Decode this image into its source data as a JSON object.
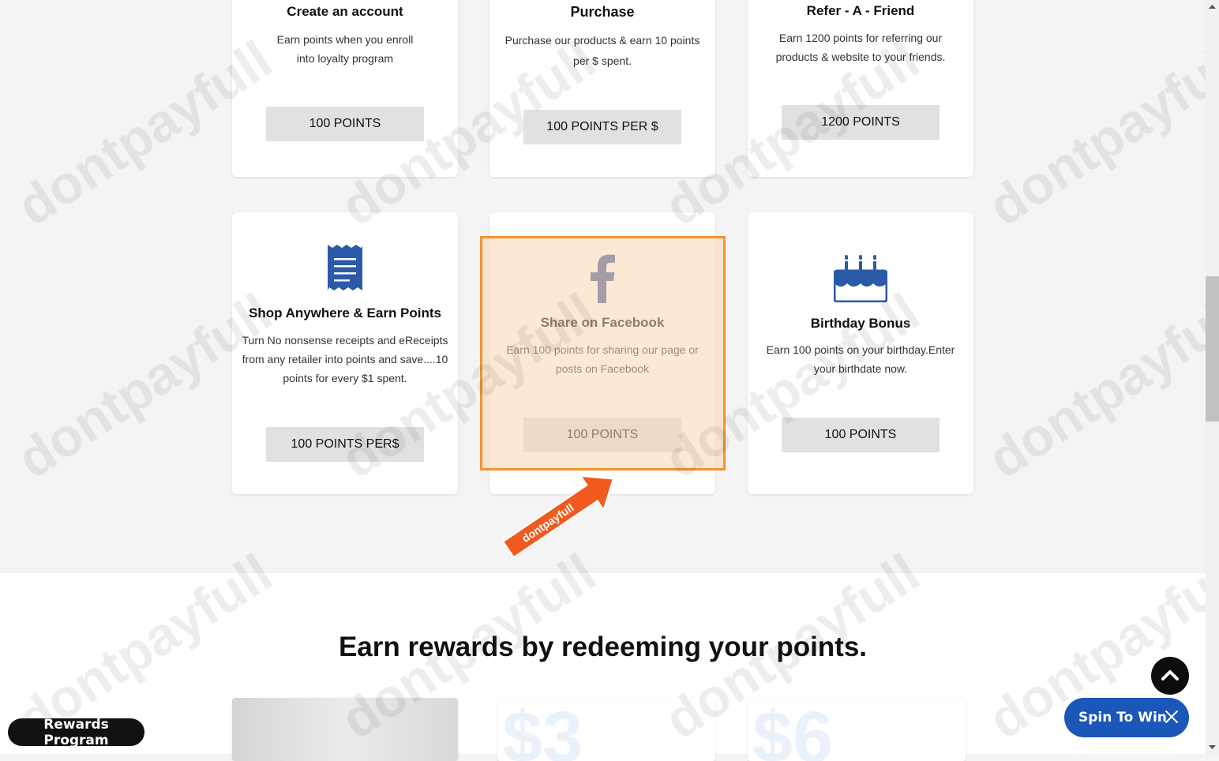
{
  "earn_cards": [
    {
      "title": "Create an account",
      "description": "Earn points when you enroll into loyalty program",
      "button": "100 POINTS"
    },
    {
      "title": "Purchase",
      "description": "Purchase our products & earn 10 points per $ spent.",
      "button": "100 POINTS PER $"
    },
    {
      "title": "Refer - A - Friend",
      "description": "Earn 1200 points for referring our products & website to your friends.",
      "button": "1200 POINTS"
    },
    {
      "title": "Shop Anywhere & Earn Points",
      "description": "Turn No nonsense receipts and eReceipts from any retailer into points and save....10 points for every $1 spent.",
      "button": "100 POINTS PER$",
      "icon": "receipt-icon"
    },
    {
      "title": "Share on Facebook",
      "description": "Earn 100 points for sharing our page or posts on Facebook",
      "button": "100 POINTS",
      "icon": "facebook-icon"
    },
    {
      "title": "Birthday Bonus",
      "description": "Earn 100 points on your birthday.Enter your birthdate now.",
      "button": "100 POINTS",
      "icon": "birthday-cake-icon"
    }
  ],
  "arrow_label": "dontpayfull",
  "redeem_heading": "Earn rewards by redeeming your points.",
  "reward_cards": [
    {
      "amount": ""
    },
    {
      "amount": "$3"
    },
    {
      "amount": "$6"
    }
  ],
  "rewards_program_label": "Rewards Program",
  "spin_label": "Spin To Win",
  "watermark_text": "dontpayfull",
  "colors": {
    "accent": "#1a57b8",
    "highlight": "#f0952d",
    "icon_blue": "#2a5aa8",
    "facebook": "#3b5998",
    "arrow": "#f05a1e"
  }
}
